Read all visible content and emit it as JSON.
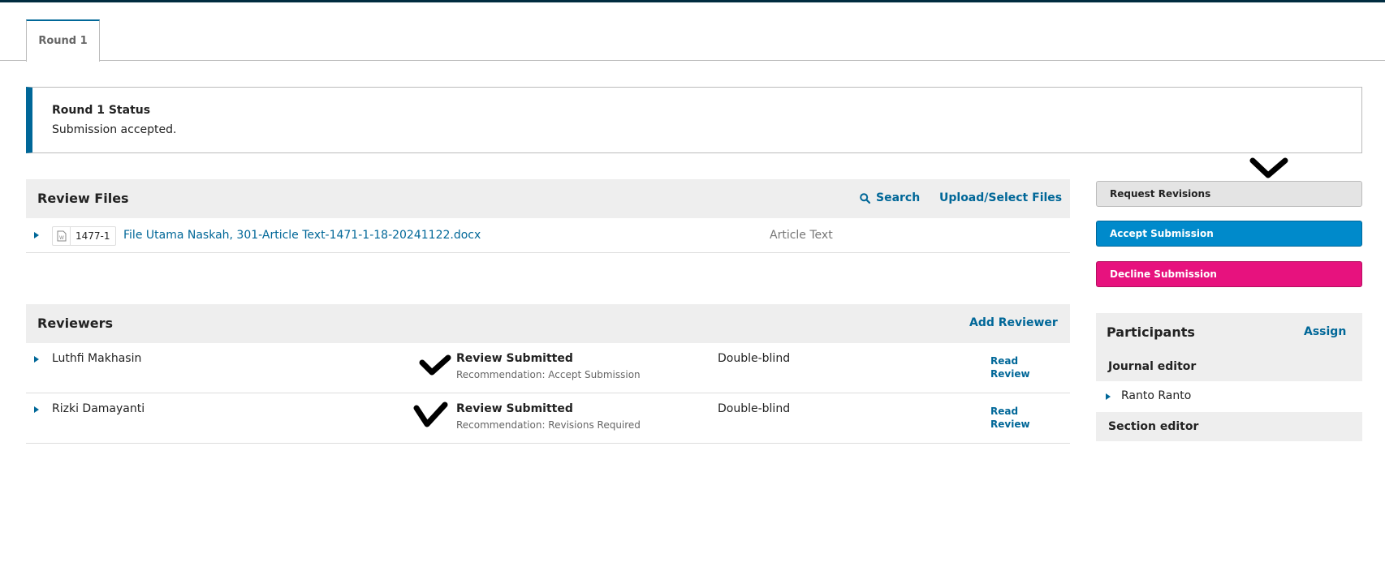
{
  "tabs": [
    {
      "label": "Round 1"
    }
  ],
  "status": {
    "title": "Round 1 Status",
    "text": "Submission accepted."
  },
  "review_files": {
    "title": "Review Files",
    "search_label": "Search",
    "upload_label": "Upload/Select Files",
    "files": [
      {
        "id": "1477-1",
        "name": "File Utama Naskah, 301-Article Text-1471-1-18-20241122.docx",
        "type": "Article Text",
        "icon": "word-document-icon"
      }
    ]
  },
  "reviewers": {
    "title": "Reviewers",
    "add_label": "Add Reviewer",
    "rows": [
      {
        "name": "Luthfi Makhasin",
        "status": "Review Submitted",
        "recommendation": "Recommendation: Accept Submission",
        "method": "Double-blind",
        "action": "Read Review"
      },
      {
        "name": "Rizki Damayanti",
        "status": "Review Submitted",
        "recommendation": "Recommendation: Revisions Required",
        "method": "Double-blind",
        "action": "Read Review"
      }
    ]
  },
  "decisions": {
    "request_revisions": "Request Revisions",
    "accept": "Accept Submission",
    "decline": "Decline Submission"
  },
  "participants": {
    "title": "Participants",
    "assign_label": "Assign",
    "groups": [
      {
        "label": "Journal editor",
        "members": [
          "Ranto Ranto"
        ]
      },
      {
        "label": "Section editor",
        "members": []
      }
    ]
  },
  "colors": {
    "primary": "#006798",
    "accept": "#008acb",
    "decline": "#e7127e",
    "panel_bg": "#eeeeee"
  }
}
